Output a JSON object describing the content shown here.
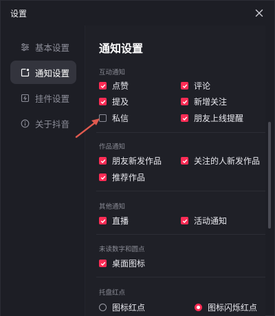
{
  "window": {
    "title": "设置"
  },
  "sidebar": {
    "items": [
      {
        "label": "基本设置",
        "icon": "sliders-icon"
      },
      {
        "label": "通知设置",
        "icon": "notification-icon"
      },
      {
        "label": "挂件设置",
        "icon": "widget-icon"
      },
      {
        "label": "关于抖音",
        "icon": "info-icon"
      }
    ]
  },
  "content": {
    "title": "通知设置",
    "sections": [
      {
        "label": "互动通知",
        "options": [
          {
            "label": "点赞",
            "checked": true
          },
          {
            "label": "评论",
            "checked": true
          },
          {
            "label": "提及",
            "checked": true
          },
          {
            "label": "新增关注",
            "checked": true
          },
          {
            "label": "私信",
            "checked": false
          },
          {
            "label": "朋友上线提醒",
            "checked": true
          }
        ]
      },
      {
        "label": "作品通知",
        "options": [
          {
            "label": "朋友新发作品",
            "checked": true
          },
          {
            "label": "关注的人新发作品",
            "checked": true
          },
          {
            "label": "推荐作品",
            "checked": true
          }
        ]
      },
      {
        "label": "其他通知",
        "options": [
          {
            "label": "直播",
            "checked": true
          },
          {
            "label": "活动通知",
            "checked": true
          }
        ]
      },
      {
        "label": "未读数字和圆点",
        "options": [
          {
            "label": "桌面图标",
            "checked": true
          }
        ]
      },
      {
        "label": "托盘红点",
        "radios": [
          {
            "label": "图标红点",
            "selected": false
          },
          {
            "label": "图标闪烁红点",
            "selected": true
          }
        ]
      }
    ]
  },
  "colors": {
    "accent": "#fe2c55",
    "background": "#1f2027",
    "annotation_arrow": "#e05a4f"
  }
}
